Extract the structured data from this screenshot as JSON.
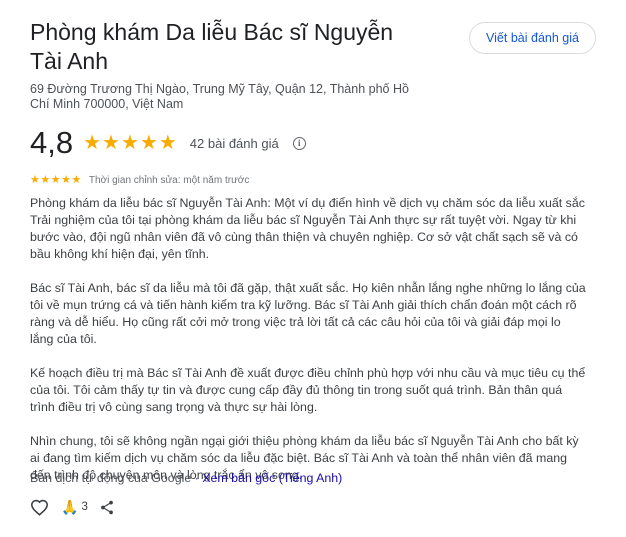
{
  "place": {
    "name": "Phòng khám Da liễu Bác sĩ Nguyễn Tài Anh",
    "address": "69 Đường Trương Thị Ngào, Trung Mỹ Tây, Quận 12, Thành phố Hồ Chí Minh 700000, Việt Nam"
  },
  "write_review_label": "Viết bài đánh giá",
  "rating": {
    "value": "4,8",
    "stars": 5,
    "count_label": "42 bài đánh giá"
  },
  "review": {
    "stars": 5,
    "edit_time": "Thời gian chỉnh sửa: một năm trước",
    "paragraphs": [
      "Phòng khám da liễu bác sĩ Nguyễn Tài Anh: Một ví dụ điển hình về dịch vụ chăm sóc da liễu xuất sắc Trải nghiệm của tôi tại phòng khám da liễu bác sĩ Nguyễn Tài Anh thực sự rất tuyệt vời. Ngay từ khi bước vào, đội ngũ nhân viên đã vô cùng thân thiện và chuyên nghiệp. Cơ sở vật chất sạch sẽ và có bầu không khí hiện đại, yên tĩnh.",
      "Bác sĩ Tài Anh, bác sĩ da liễu mà tôi đã gặp, thật xuất sắc. Họ kiên nhẫn lắng nghe những lo lắng của tôi về mụn trứng cá và tiến hành kiểm tra kỹ lưỡng. Bác sĩ Tài Anh giải thích chẩn đoán một cách rõ ràng và dễ hiểu. Họ cũng rất cởi mở trong việc trả lời tất cả các câu hỏi của tôi và giải đáp mọi lo lắng của tôi.",
      "Kế hoạch điều trị mà Bác sĩ Tài Anh đề xuất được điều chỉnh phù hợp với nhu cầu và mục tiêu cụ thể của tôi. Tôi cảm thấy tự tin và được cung cấp đầy đủ thông tin trong suốt quá trình. Bản thân quá trình điều trị vô cùng sang trọng và thực sự hài lòng.",
      "Nhìn chung, tôi sẽ không ngần ngại giới thiệu phòng khám da liễu bác sĩ Nguyễn Tài Anh cho bất kỳ ai đang tìm kiếm dịch vụ chăm sóc da liễu đặc biệt. Bác sĩ Tài Anh và toàn thể nhân viên đã mang đến trình độ chuyên môn và lòng trắc ẩn vô song."
    ],
    "translation_note": "Bản dịch tự động của Google · ",
    "view_original_label": "Xem bản gốc (Tiếng Anh)",
    "reaction_count": "3"
  },
  "icons": {
    "star": "star-icon",
    "info": "info-icon",
    "like": "heart-icon",
    "reaction": "folded-hands-icon",
    "share": "share-icon"
  },
  "colors": {
    "star": "#f9ab00",
    "link": "#1a0dab",
    "text": "#202124"
  }
}
